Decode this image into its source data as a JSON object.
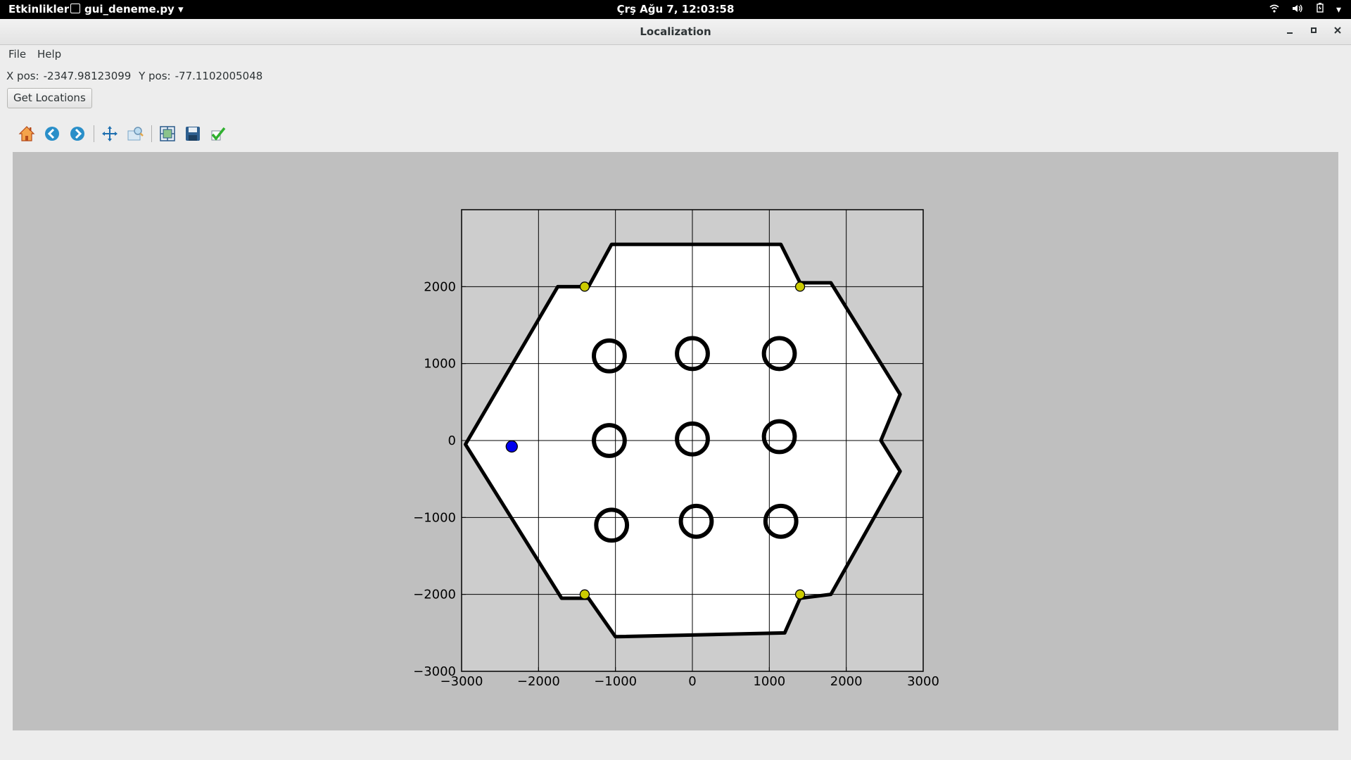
{
  "topbar": {
    "activities": "Etkinlikler",
    "app_name": "gui_deneme.py",
    "clock": "Çrş Ağu  7, 12:03:58"
  },
  "window": {
    "title": "Localization"
  },
  "menu": {
    "file": "File",
    "help": "Help"
  },
  "position": {
    "x_label": "X pos:",
    "x_value": "-2347.98123099",
    "y_label": "Y pos:",
    "y_value": "-77.1102005048"
  },
  "buttons": {
    "get_locations": "Get Locations"
  },
  "toolbar": {
    "icons": [
      "home-icon",
      "back-icon",
      "forward-icon",
      "pan-icon",
      "zoom-icon",
      "configure-subplots-icon",
      "save-icon",
      "edit-check-icon"
    ]
  },
  "chart_data": {
    "type": "scatter",
    "xlim": [
      -3000,
      3000
    ],
    "ylim": [
      -3000,
      3000
    ],
    "xticks": [
      -3000,
      -2000,
      -1000,
      0,
      1000,
      2000,
      3000
    ],
    "yticks": [
      -3000,
      -2000,
      -1000,
      0,
      1000,
      2000
    ],
    "grid": true,
    "background_map": "occupancy grid: hexagonal arena with 9 circular obstacles",
    "obstacles": [
      [
        -1080,
        1100
      ],
      [
        0,
        1130
      ],
      [
        1130,
        1130
      ],
      [
        -1080,
        0
      ],
      [
        0,
        20
      ],
      [
        1130,
        50
      ],
      [
        -1050,
        -1100
      ],
      [
        50,
        -1050
      ],
      [
        1150,
        -1050
      ]
    ],
    "series": [
      {
        "color": "#cccc00",
        "points": [
          [
            -1400,
            2000
          ],
          [
            1400,
            2000
          ],
          [
            -1400,
            -2000
          ],
          [
            1400,
            -2000
          ]
        ]
      },
      {
        "color": "#0000ee",
        "points": [
          [
            -2347.98,
            -77.11
          ]
        ]
      }
    ]
  }
}
